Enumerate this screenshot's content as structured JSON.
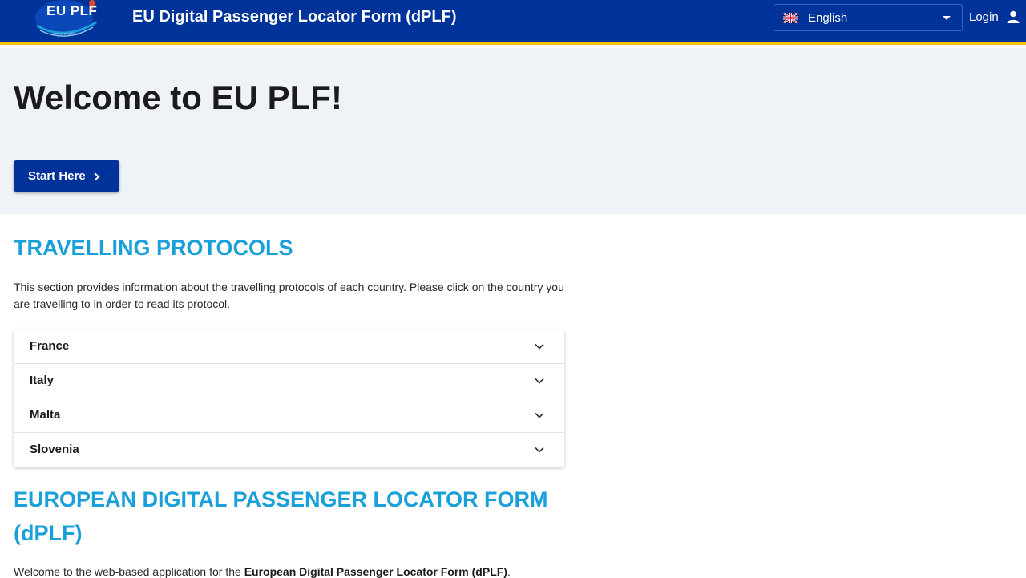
{
  "header": {
    "logo_text": "EU PLF",
    "logo_url": "www.euplf.eu",
    "title": "EU Digital Passenger Locator Form (dPLF)",
    "language": {
      "selected": "English",
      "flag_icon": "uk-flag-icon"
    },
    "login_label": "Login",
    "login_icon": "user-icon"
  },
  "hero": {
    "title": "Welcome to EU PLF!",
    "start_label": "Start Here",
    "start_icon": "chevron-right-icon"
  },
  "protocols": {
    "heading": "TRAVELLING PROTOCOLS",
    "description": "This section provides information about the travelling protocols of each country. Please click on the country you are travelling to in order to read its protocol.",
    "countries": [
      {
        "label": "France"
      },
      {
        "label": "Italy"
      },
      {
        "label": "Malta"
      },
      {
        "label": "Slovenia"
      }
    ],
    "expand_icon": "chevron-down-icon"
  },
  "dplf": {
    "heading": "EUROPEAN DIGITAL PASSENGER LOCATOR FORM (dPLF)",
    "intro_prefix": "Welcome to the web-based application for the ",
    "intro_bold": "European Digital Passenger Locator Form (dPLF)",
    "intro_suffix": "."
  },
  "colors": {
    "brand_blue": "#003399",
    "accent_yellow": "#f5c400",
    "heading_cyan": "#1aa0d9",
    "hero_bg": "#eff2f7"
  }
}
